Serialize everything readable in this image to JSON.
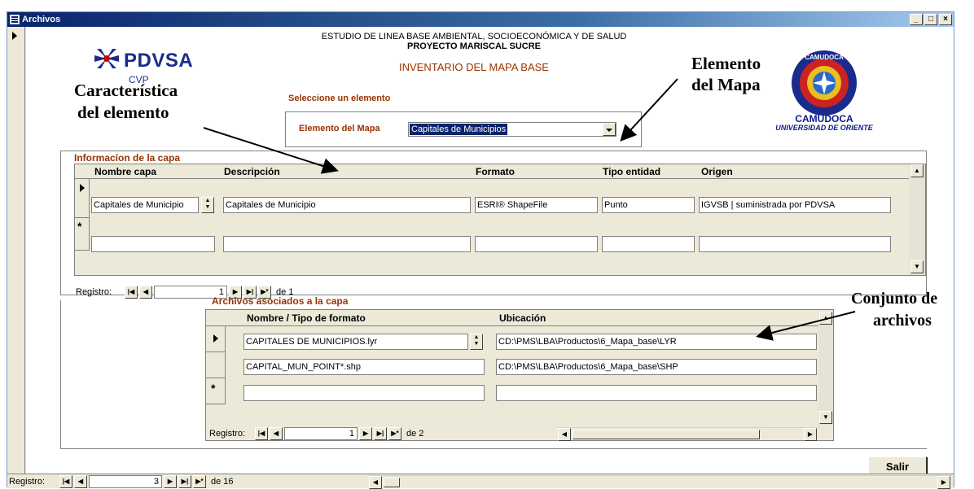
{
  "window": {
    "title": "Archivos",
    "minimize_glyph": "_",
    "maximize_glyph": "□",
    "close_glyph": "×"
  },
  "header": {
    "study_line": "ESTUDIO DE LINEA BASE AMBIENTAL, SOCIOECONÓMICA Y DE SALUD",
    "project_line": "PROYECTO MARISCAL SUCRE",
    "inventory_title": "INVENTARIO DEL MAPA BASE",
    "select_prompt": "Seleccione un elemento"
  },
  "logos": {
    "pdvsa_name": "PDVSA",
    "pdvsa_sub": "CVP",
    "camudoca_name": "CAMUDOCA",
    "camudoca_sub": "UNIVERSIDAD DE ORIENTE",
    "seal_top_text": "CAMUDOCA"
  },
  "annotations": {
    "caracteristica_line1": "Característica",
    "caracteristica_line2": "del  elemento",
    "elemento_line1": "Elemento",
    "elemento_line2": "del Mapa",
    "conjunto_line1": "Conjunto de",
    "conjunto_line2": "archivos"
  },
  "element_selector": {
    "label": "Elemento del Mapa",
    "value": "Capitales de Municipios"
  },
  "layer_section": {
    "title": "Informacíon de la capa",
    "columns": [
      "Nombre capa",
      "Descripción",
      "Formato",
      "Tipo entidad",
      "Origen"
    ],
    "row": {
      "nombre": "Capitales de Municipio",
      "descripcion": "Capitales de Municipio",
      "formato": "ESRI® ShapeFile",
      "tipo": "Punto",
      "origen": "IGVSB | suministrada por PDVSA"
    },
    "nav": {
      "label": "Registro:",
      "current": "1",
      "of_text": "de 1"
    }
  },
  "files_section": {
    "title": "Archivos asociados a la capa",
    "columns": [
      "Nombre / Tipo de formato",
      "Ubicación"
    ],
    "rows": [
      {
        "nombre": "CAPITALES DE MUNICIPIOS.lyr",
        "ubicacion": "CD:\\PMS\\LBA\\Productos\\6_Mapa_base\\LYR"
      },
      {
        "nombre": "CAPITAL_MUN_POINT*.shp",
        "ubicacion": "CD:\\PMS\\LBA\\Productos\\6_Mapa_base\\SHP"
      }
    ],
    "nav": {
      "label": "Registro:",
      "current": "1",
      "of_text": "de 2"
    }
  },
  "footer": {
    "exit_label": "Salir",
    "nav": {
      "label": "Registro:",
      "current": "3",
      "of_text": "de 16"
    }
  },
  "nav_glyphs": {
    "first": "|◀",
    "prev": "◀",
    "next": "▶",
    "last": "▶|",
    "new": "▶*"
  },
  "new_row_marker": "*",
  "colors": {
    "section_title": "#993300",
    "title_bar": "#0a246a",
    "pdvsa_red": "#cc0000",
    "pdvsa_blue": "#1a2b8c",
    "camudoca_blue": "#0a1a8c"
  }
}
